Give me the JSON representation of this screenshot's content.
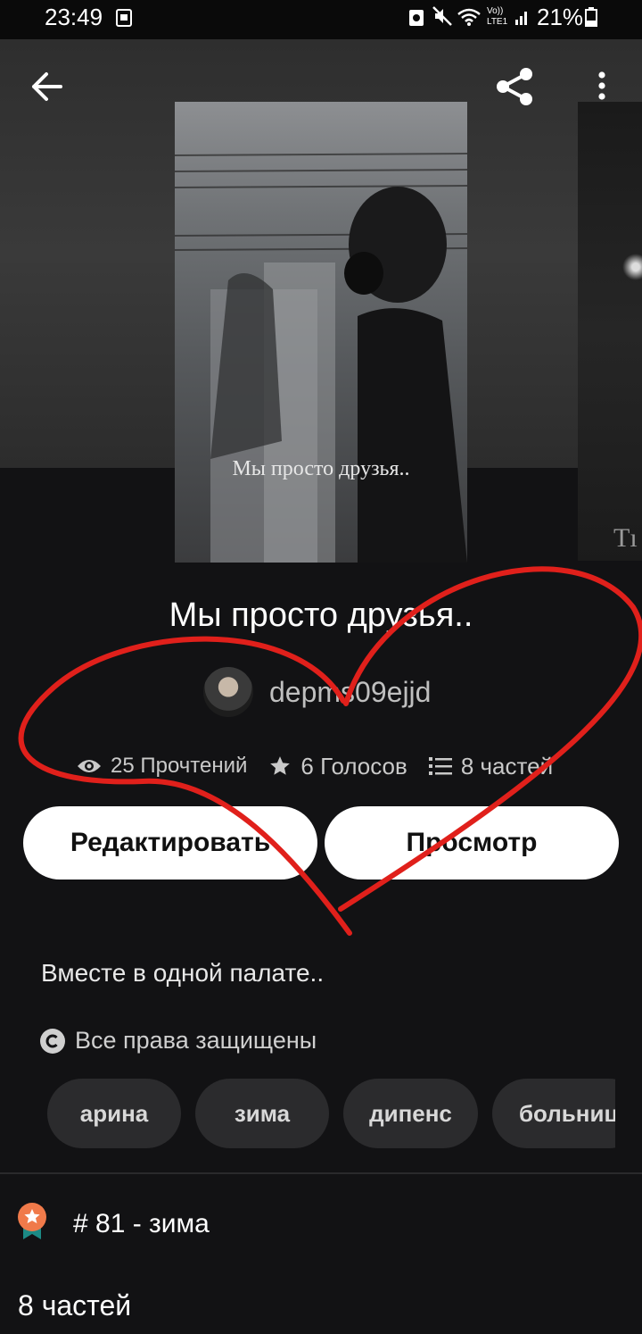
{
  "status_bar": {
    "time": "23:49",
    "battery": "21%"
  },
  "story": {
    "cover_title": "Мы просто друзья..",
    "next_cover_partial_text": "Tı",
    "title": "Мы просто друзья..",
    "author": "depms09ejjd",
    "stats": {
      "reads": "25 Прочтений",
      "votes": "6 Голосов",
      "parts": "8 частей"
    },
    "buttons": {
      "edit": "Редактировать",
      "view": "Просмотр"
    },
    "description": "Вместе в одной палате..",
    "copyright": "Все права защищены",
    "tags": [
      "арина",
      "зима",
      "дипенс",
      "больниц"
    ],
    "rank": "# 81 - зима",
    "parts_heading": "8 частей"
  },
  "colors": {
    "background": "#121214",
    "button_bg": "#ffffff",
    "tag_bg": "#2b2b2d",
    "annotation": "#e0201b",
    "rank_badge": "#f07a4a"
  },
  "icons": [
    "back-arrow-icon",
    "share-icon",
    "more-vert-icon",
    "eye-icon",
    "star-icon",
    "list-icon",
    "copyright-icon",
    "rank-badge-icon"
  ]
}
